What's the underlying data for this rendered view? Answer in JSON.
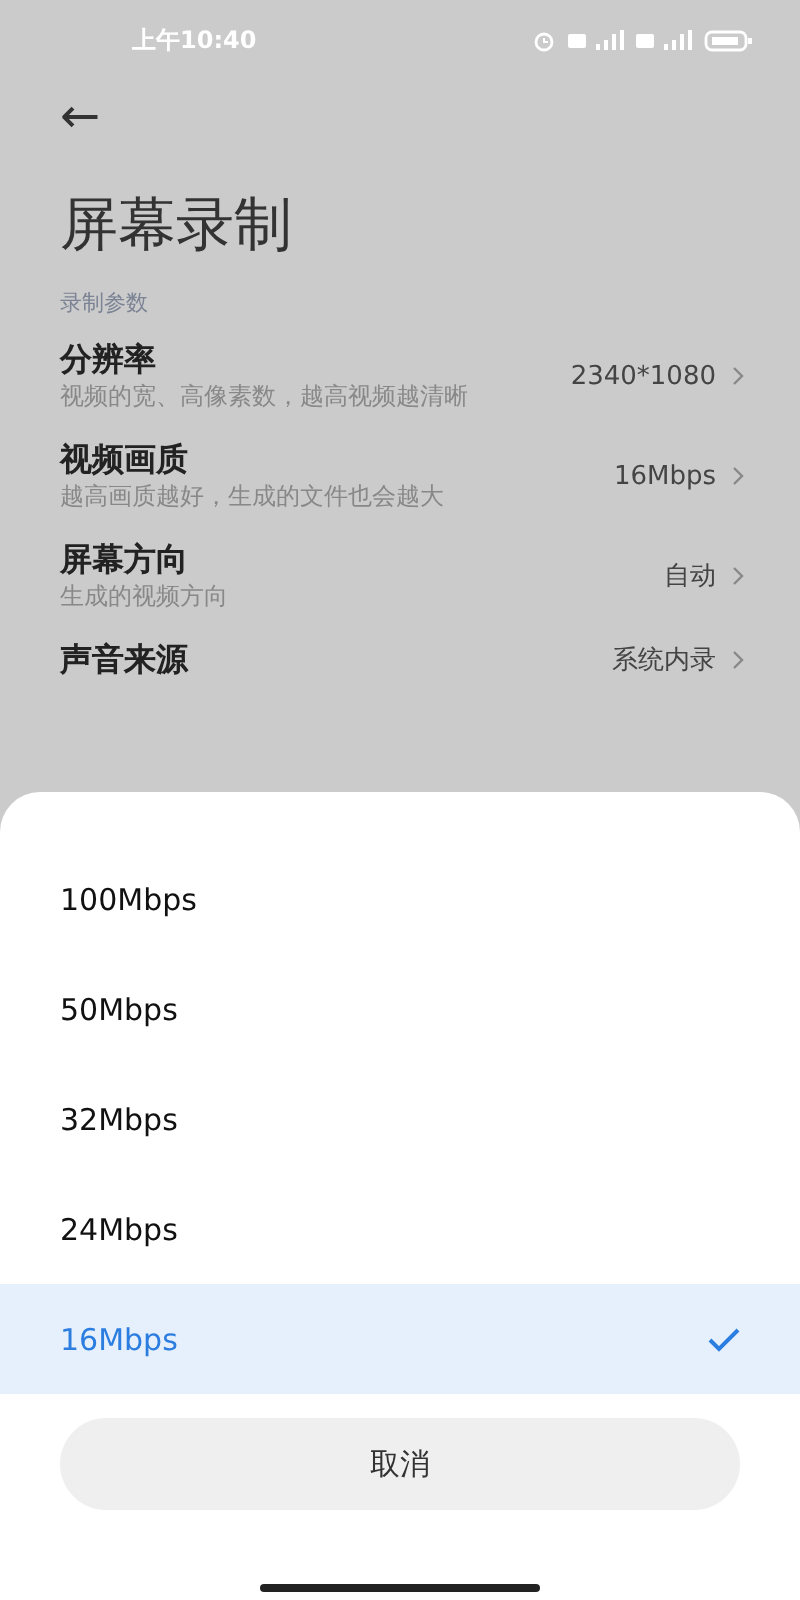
{
  "status_bar": {
    "time": "上午10:40"
  },
  "header": {
    "back": "←",
    "title": "屏幕录制"
  },
  "section": {
    "label": "录制参数"
  },
  "settings": [
    {
      "title": "分辨率",
      "description": "视频的宽、高像素数，越高视频越清晰",
      "value": "2340*1080"
    },
    {
      "title": "视频画质",
      "description": "越高画质越好，生成的文件也会越大",
      "value": "16Mbps"
    },
    {
      "title": "屏幕方向",
      "description": "生成的视频方向",
      "value": "自动"
    },
    {
      "title": "声音来源",
      "value": "系统内录"
    }
  ],
  "sheet": {
    "options": [
      {
        "label": "100Mbps",
        "selected": false
      },
      {
        "label": "50Mbps",
        "selected": false
      },
      {
        "label": "32Mbps",
        "selected": false
      },
      {
        "label": "24Mbps",
        "selected": false
      },
      {
        "label": "16Mbps",
        "selected": true
      }
    ],
    "cancel": "取消"
  }
}
